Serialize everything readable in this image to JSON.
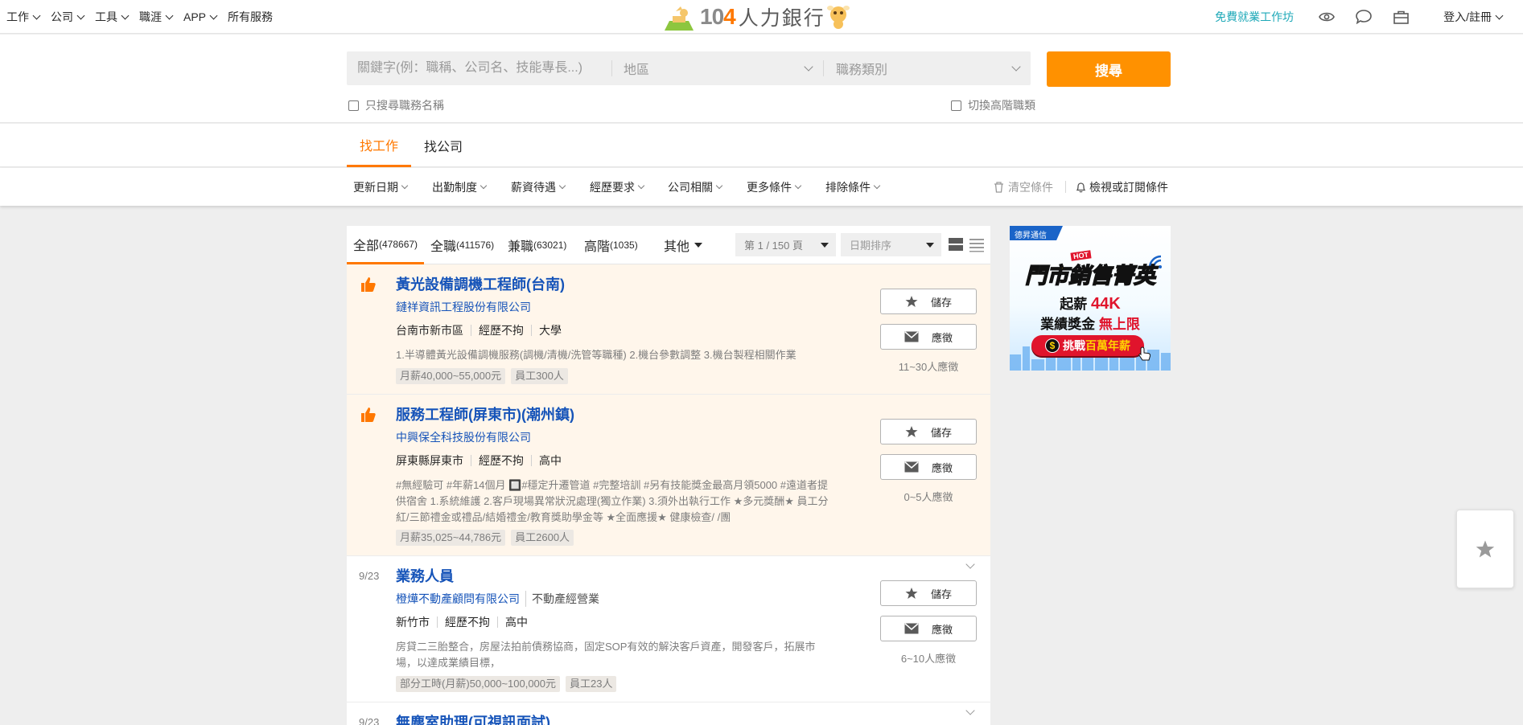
{
  "topnav": {
    "menu": [
      {
        "label": "工作"
      },
      {
        "label": "公司"
      },
      {
        "label": "工具"
      },
      {
        "label": "職涯"
      },
      {
        "label": "APP"
      },
      {
        "label": "所有服務"
      }
    ],
    "logo_number": "104",
    "logo_text": "人力銀行",
    "workshop_link": "免費就業工作坊",
    "login": "登入/註冊"
  },
  "search": {
    "keyword_placeholder": "關鍵字(例：職稱、公司名、技能專長...)",
    "area_placeholder": "地區",
    "category_placeholder": "職務類別",
    "button_label": "搜尋",
    "title_only_label": "只搜尋職務名稱",
    "advanced_label": "切換高階職類"
  },
  "tabs": {
    "find_job": "找工作",
    "find_company": "找公司"
  },
  "filters": {
    "items": [
      "更新日期",
      "出勤制度",
      "薪資待遇",
      "經歷要求",
      "公司相關",
      "更多條件",
      "排除條件"
    ],
    "clear_label": "清空條件",
    "subscribe_label": "檢視或訂閱條件"
  },
  "list": {
    "tabs": [
      {
        "label": "全部",
        "count": "(478667)"
      },
      {
        "label": "全職",
        "count": "(411576)"
      },
      {
        "label": "兼職",
        "count": "(63021)"
      },
      {
        "label": "高階",
        "count": "(1035)"
      }
    ],
    "other_label": "其他",
    "page_select": "第 1 / 150 頁",
    "sort_select": "日期排序"
  },
  "jobs": [
    {
      "date": "",
      "title": "黃光設備調機工程師(台南)",
      "company": "鏈祥資訊工程股份有限公司",
      "industry": "",
      "meta": [
        "台南市新市區",
        "經歷不拘",
        "大學"
      ],
      "description": "1.半導體黃光設備調機服務(調機/清機/洗管等職種) 2.機台參數調整 3.機台製程相關作業",
      "tags": [
        "月薪40,000~55,000元",
        "員工300人"
      ],
      "save_label": "儲存",
      "apply_label": "應徵",
      "applicants": "11~30人應徵"
    },
    {
      "date": "",
      "title": "服務工程師(屏東市)(潮州鎮)",
      "company": "中興保全科技股份有限公司",
      "industry": "",
      "meta": [
        "屏東縣屏東市",
        "經歷不拘",
        "高中"
      ],
      "description": "#無經驗可 #年薪14個月 🔲#穩定升遷管道 #完整培訓 #另有技能獎金最高月領5000 #遠道者提供宿舍 1.系統維護 2.客戶現場異常狀況處理(獨立作業) 3.須外出執行工作 ★多元獎酬★ 員工分紅/三節禮金或禮品/結婚禮金/教育獎助學金等 ★全面應援★ 健康檢查/ /團",
      "tags": [
        "月薪35,025~44,786元",
        "員工2600人"
      ],
      "save_label": "儲存",
      "apply_label": "應徵",
      "applicants": "0~5人應徵"
    },
    {
      "date": "9/23",
      "title": "業務人員",
      "company": "橙燁不動產顧問有限公司",
      "industry": "不動產經營業",
      "meta": [
        "新竹市",
        "經歷不拘",
        "高中"
      ],
      "description": "房貸二三胎整合，房屋法拍前債務協商，固定SOP有效的解決客戶資產，開發客戶，拓展市場，以達成業績目標，",
      "tags": [
        "部分工時(月薪)50,000~100,000元",
        "員工23人"
      ],
      "save_label": "儲存",
      "apply_label": "應徵",
      "applicants": "6~10人應徵"
    },
    {
      "date": "9/23",
      "title": "無塵室助理(可視訊面試)",
      "company": "",
      "industry": "",
      "meta": [],
      "description": "",
      "tags": [],
      "save_label": "",
      "apply_label": "",
      "applicants": ""
    }
  ],
  "ad": {
    "brand": "德昇通信",
    "hot": "HOT",
    "title": "門市銷售菁英",
    "line2_prefix": "起薪",
    "line2_value": "44K",
    "line3_prefix": "業績獎金",
    "line3_value": "無上限",
    "cta_prefix": "挑戰",
    "cta_value": "百萬年薪",
    "coin_symbol": "$"
  },
  "colors": {
    "accent_orange": "#ff9100",
    "link_blue": "#1654b9",
    "workshop_teal": "#1fa9b8",
    "highlight_bg": "#fff6eb"
  }
}
